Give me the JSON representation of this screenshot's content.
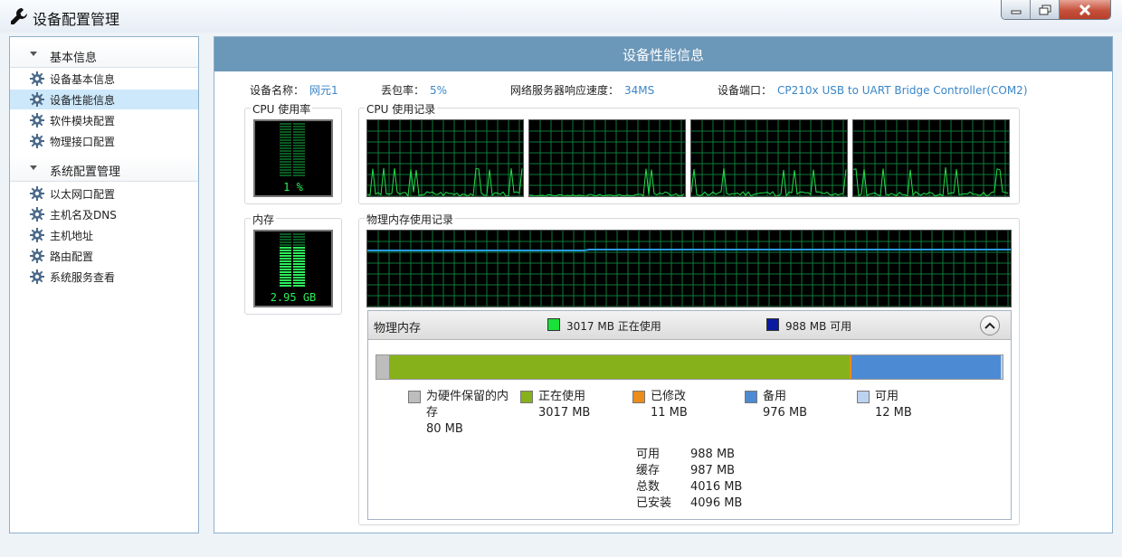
{
  "window": {
    "title": "设备配置管理",
    "buttons": [
      "minimize",
      "restore",
      "close"
    ]
  },
  "sidebar": {
    "groups": [
      {
        "label": "基本信息",
        "items": [
          {
            "label": "设备基本信息",
            "selected": false
          },
          {
            "label": "设备性能信息",
            "selected": true
          },
          {
            "label": "软件模块配置",
            "selected": false
          },
          {
            "label": "物理接口配置",
            "selected": false
          }
        ]
      },
      {
        "label": "系统配置管理",
        "items": [
          {
            "label": "以太网口配置",
            "selected": false
          },
          {
            "label": "主机名及DNS",
            "selected": false
          },
          {
            "label": "主机地址",
            "selected": false
          },
          {
            "label": "路由配置",
            "selected": false
          },
          {
            "label": "系统服务查看",
            "selected": false
          }
        ]
      }
    ]
  },
  "panel": {
    "title": "设备性能信息",
    "info": [
      {
        "key": "设备名称：",
        "value": "网元1"
      },
      {
        "key": "丢包率：",
        "value": "5%"
      },
      {
        "key": "网络服务器响应速度：",
        "value": "34MS"
      },
      {
        "key": "设备端口：",
        "value": "CP210x USB to UART Bridge Controller(COM2)"
      }
    ],
    "cpu": {
      "title": "CPU 使用率",
      "value": "1 %"
    },
    "cpu_history": {
      "title": "CPU 使用记录"
    },
    "memory": {
      "title": "内存",
      "value": "2.95 GB"
    },
    "memory_history": {
      "title": "物理内存使用记录"
    },
    "physical_memory": {
      "title": "物理内存",
      "in_use_summary": "3017 MB 正在使用",
      "available_summary": "988 MB 可用",
      "colors": {
        "reserved": "#bdbdbd",
        "in_use": "#86b11b",
        "modified": "#ea8d1a",
        "standby": "#4d8ad4",
        "free": "#bcd2ef",
        "in_use_summary_swatch": "#19e13a",
        "available_summary_swatch": "#0a1aa0"
      },
      "legend": [
        {
          "key": "reserved",
          "label": "为硬件保留的内存",
          "value": "80 MB",
          "mb": 80
        },
        {
          "key": "in_use",
          "label": "正在使用",
          "value": "3017 MB",
          "mb": 3017
        },
        {
          "key": "modified",
          "label": "已修改",
          "value": "11 MB",
          "mb": 11
        },
        {
          "key": "standby",
          "label": "备用",
          "value": "976 MB",
          "mb": 976
        },
        {
          "key": "free",
          "label": "可用",
          "value": "12 MB",
          "mb": 12
        }
      ],
      "stats": [
        {
          "label": "可用",
          "value": "988 MB"
        },
        {
          "label": "缓存",
          "value": "987 MB"
        },
        {
          "label": "总数",
          "value": "4016 MB"
        },
        {
          "label": "已安装",
          "value": "4096 MB"
        }
      ]
    }
  }
}
